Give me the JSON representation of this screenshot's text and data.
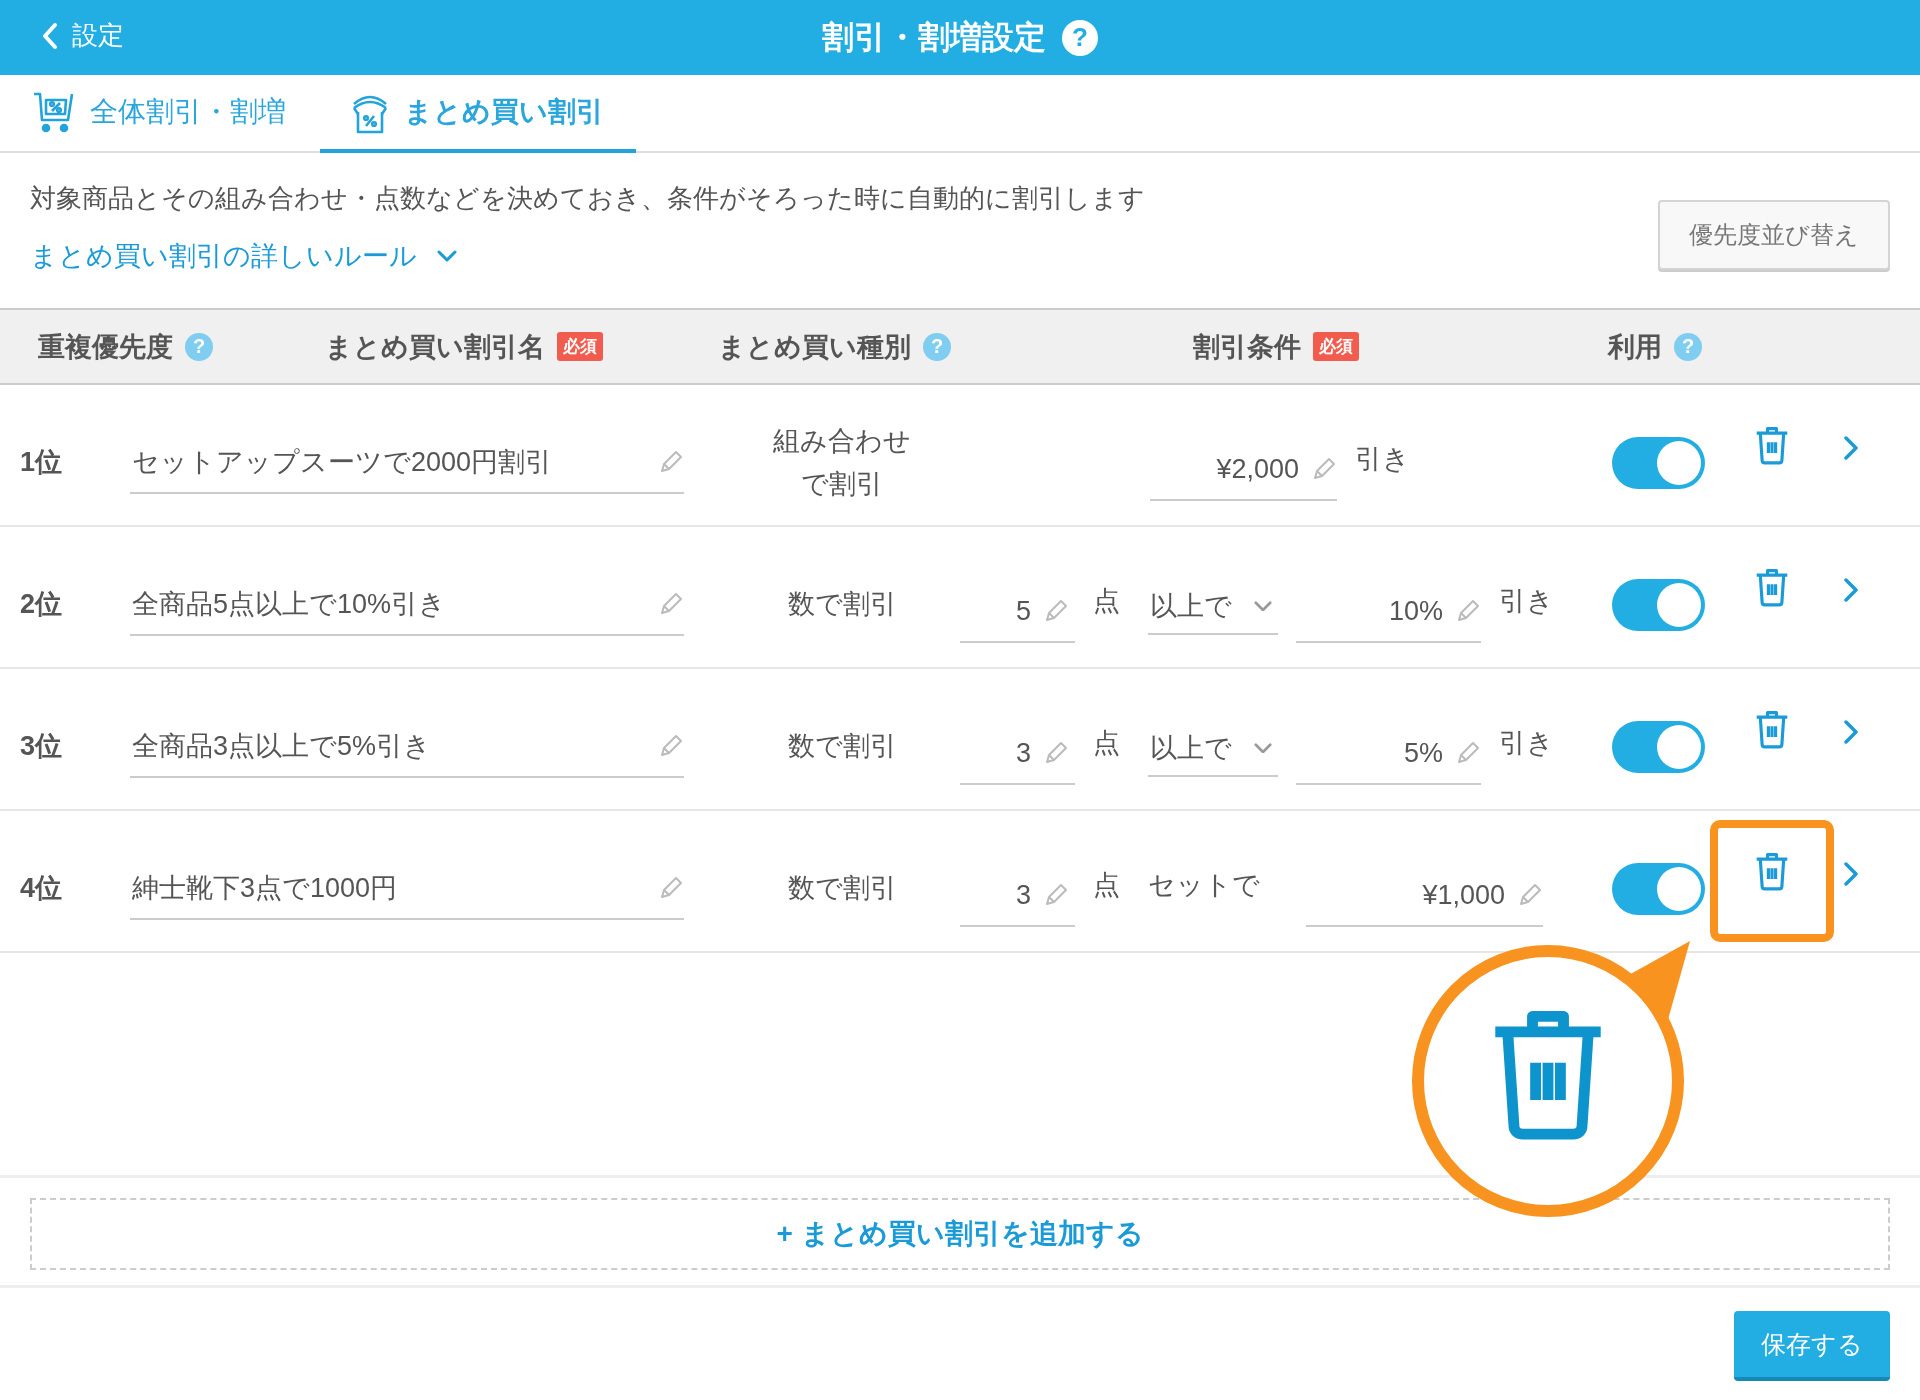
{
  "top_bar": {
    "back_label": "設定",
    "title": "割引・割増設定",
    "help": "?"
  },
  "tabs": [
    {
      "label": "全体割引・割増",
      "selected": false
    },
    {
      "label": "まとめ買い割引",
      "selected": true
    }
  ],
  "intro": {
    "description": "対象商品とその組み合わせ・点数などを決めておき、条件がそろった時に自動的に割引します",
    "rules_link": "まとめ買い割引の詳しいルール",
    "sort_button": "優先度並び替え"
  },
  "table": {
    "columns": [
      {
        "label": "重複優先度",
        "help": "?"
      },
      {
        "label": "まとめ買い割引名",
        "badge": "必須"
      },
      {
        "label": "まとめ買い種別",
        "help": "?"
      },
      {
        "label": "割引条件",
        "badge": "必須"
      },
      {
        "label": "利用",
        "help": "?"
      }
    ],
    "rows": [
      {
        "rank": "1位",
        "name": "セットアップスーツで2000円割引",
        "type": "組み合わせで割引",
        "condition": {
          "kind": "amount",
          "amount": "¥2,000",
          "suffix": "引き"
        },
        "on": true,
        "highlighted": false
      },
      {
        "rank": "2位",
        "name": "全商品5点以上で10%引き",
        "type": "数で割引",
        "condition": {
          "kind": "quantity",
          "quantity": "5",
          "unit": "点",
          "mode": {
            "kind": "select",
            "label": "以上で"
          },
          "amount": "10%",
          "suffix": "引き"
        },
        "on": true,
        "highlighted": false
      },
      {
        "rank": "3位",
        "name": "全商品3点以上で5%引き",
        "type": "数で割引",
        "condition": {
          "kind": "quantity",
          "quantity": "3",
          "unit": "点",
          "mode": {
            "kind": "select",
            "label": "以上で"
          },
          "amount": "5%",
          "suffix": "引き"
        },
        "on": true,
        "highlighted": false
      },
      {
        "rank": "4位",
        "name": "紳士靴下3点で1000円",
        "type": "数で割引",
        "condition": {
          "kind": "quantity",
          "quantity": "3",
          "unit": "点",
          "mode": {
            "kind": "text",
            "label": "セットで"
          },
          "amount": "¥1,000"
        },
        "on": true,
        "highlighted": true
      }
    ]
  },
  "add_button": "+ まとめ買い割引を追加する",
  "save_button": "保存する"
}
